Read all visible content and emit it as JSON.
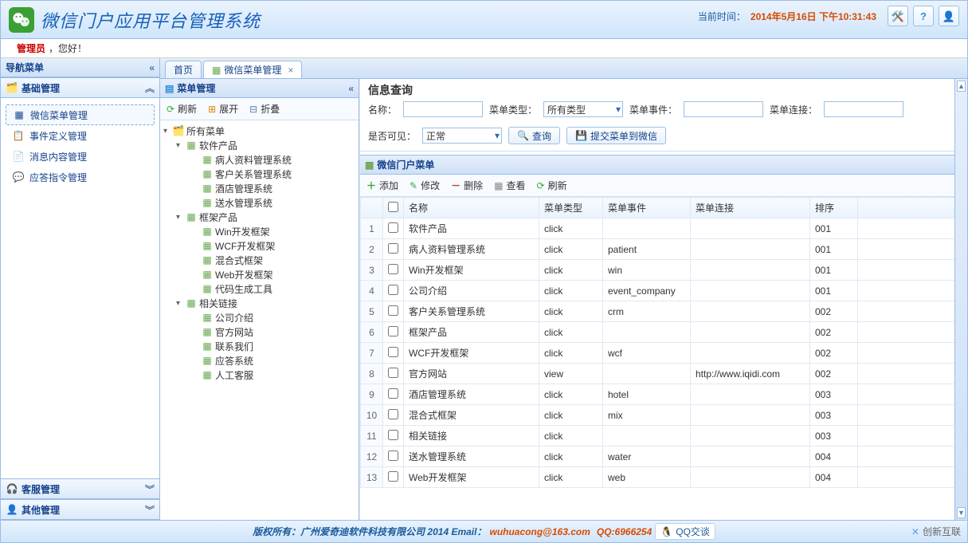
{
  "header": {
    "title": "微信门户应用平台管理系统",
    "time_label": "当前时间：",
    "time_value": "2014年5月16日 下午10:31:43"
  },
  "welcome": {
    "user": "管理员",
    "greeting": "，您好！"
  },
  "sidebar": {
    "title": "导航菜单",
    "sections": [
      {
        "title": "基础管理",
        "expanded": true,
        "icon": "tree-icon"
      },
      {
        "title": "客服管理",
        "expanded": false,
        "icon": "headset-icon"
      },
      {
        "title": "其他管理",
        "expanded": false,
        "icon": "user-icon"
      }
    ],
    "items": [
      {
        "label": "微信菜单管理",
        "icon": "menu-icon",
        "active": true
      },
      {
        "label": "事件定义管理",
        "icon": "event-icon"
      },
      {
        "label": "消息内容管理",
        "icon": "message-icon"
      },
      {
        "label": "应答指令管理",
        "icon": "chat-icon"
      }
    ]
  },
  "tabs": [
    {
      "label": "首页",
      "closable": false,
      "active": false
    },
    {
      "label": "微信菜单管理",
      "closable": true,
      "active": true
    }
  ],
  "tree": {
    "title": "菜单管理",
    "toolbar": {
      "refresh": "刷新",
      "expand": "展开",
      "collapse": "折叠"
    },
    "nodes": [
      {
        "label": "所有菜单",
        "depth": 0,
        "expanded": true
      },
      {
        "label": "软件产品",
        "depth": 1,
        "expanded": true
      },
      {
        "label": "病人资料管理系统",
        "depth": 2
      },
      {
        "label": "客户关系管理系统",
        "depth": 2
      },
      {
        "label": "酒店管理系统",
        "depth": 2
      },
      {
        "label": "送水管理系统",
        "depth": 2
      },
      {
        "label": "框架产品",
        "depth": 1,
        "expanded": true
      },
      {
        "label": "Win开发框架",
        "depth": 2
      },
      {
        "label": "WCF开发框架",
        "depth": 2
      },
      {
        "label": "混合式框架",
        "depth": 2
      },
      {
        "label": "Web开发框架",
        "depth": 2
      },
      {
        "label": "代码生成工具",
        "depth": 2
      },
      {
        "label": "相关链接",
        "depth": 1,
        "expanded": true
      },
      {
        "label": "公司介绍",
        "depth": 2
      },
      {
        "label": "官方网站",
        "depth": 2
      },
      {
        "label": "联系我们",
        "depth": 2
      },
      {
        "label": "应答系统",
        "depth": 2
      },
      {
        "label": "人工客服",
        "depth": 2
      }
    ]
  },
  "query": {
    "title": "信息查询",
    "name_label": "名称：",
    "type_label": "菜单类型：",
    "type_value": "所有类型",
    "event_label": "菜单事件：",
    "link_label": "菜单连接：",
    "visible_label": "是否可见：",
    "visible_value": "正常",
    "search_btn": "查询",
    "submit_btn": "提交菜单到微信"
  },
  "grid": {
    "title": "微信门户菜单",
    "toolbar": {
      "add": "添加",
      "edit": "修改",
      "del": "删除",
      "view": "查看",
      "refresh": "刷新"
    },
    "columns": {
      "name": "名称",
      "type": "菜单类型",
      "event": "菜单事件",
      "link": "菜单连接",
      "sort": "排序"
    },
    "rows": [
      {
        "name": "软件产品",
        "type": "click",
        "event": "",
        "link": "",
        "sort": "001"
      },
      {
        "name": "病人资料管理系统",
        "type": "click",
        "event": "patient",
        "link": "",
        "sort": "001"
      },
      {
        "name": "Win开发框架",
        "type": "click",
        "event": "win",
        "link": "",
        "sort": "001"
      },
      {
        "name": "公司介绍",
        "type": "click",
        "event": "event_company",
        "link": "",
        "sort": "001"
      },
      {
        "name": "客户关系管理系统",
        "type": "click",
        "event": "crm",
        "link": "",
        "sort": "002"
      },
      {
        "name": "框架产品",
        "type": "click",
        "event": "",
        "link": "",
        "sort": "002"
      },
      {
        "name": "WCF开发框架",
        "type": "click",
        "event": "wcf",
        "link": "",
        "sort": "002"
      },
      {
        "name": "官方网站",
        "type": "view",
        "event": "",
        "link": "http://www.iqidi.com",
        "sort": "002"
      },
      {
        "name": "酒店管理系统",
        "type": "click",
        "event": "hotel",
        "link": "",
        "sort": "003"
      },
      {
        "name": "混合式框架",
        "type": "click",
        "event": "mix",
        "link": "",
        "sort": "003"
      },
      {
        "name": "相关链接",
        "type": "click",
        "event": "",
        "link": "",
        "sort": "003"
      },
      {
        "name": "送水管理系统",
        "type": "click",
        "event": "water",
        "link": "",
        "sort": "004"
      },
      {
        "name": "Web开发框架",
        "type": "click",
        "event": "web",
        "link": "",
        "sort": "004"
      }
    ]
  },
  "footer": {
    "copyright": "版权所有：广州爱奇迪软件科技有限公司 2014 Email：",
    "email": "wuhuacong@163.com",
    "qq_label": "QQ:6966254",
    "qq_btn": "QQ交谈",
    "corner": "创新互联"
  },
  "colors": {
    "accent": "#15428b",
    "border": "#99bce8"
  }
}
